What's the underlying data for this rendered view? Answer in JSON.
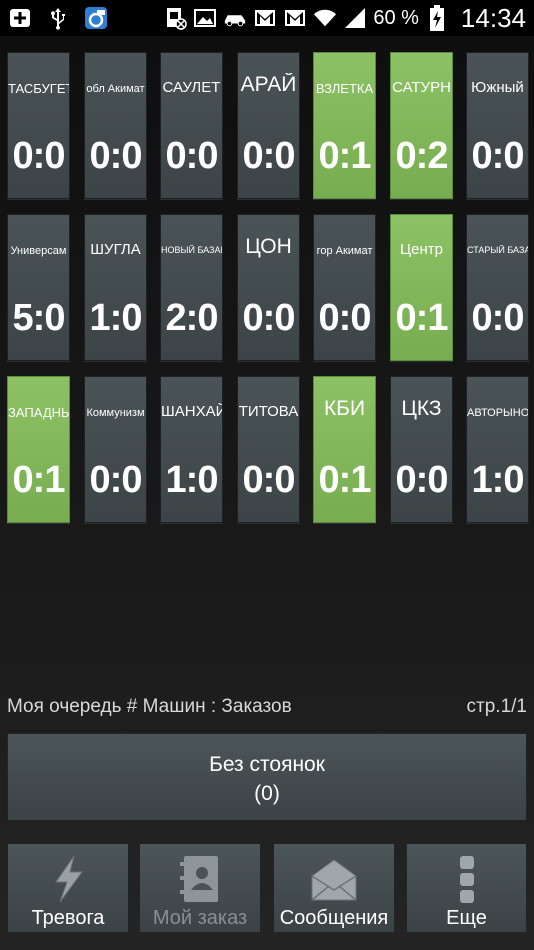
{
  "status_bar": {
    "battery_percent": "60 %",
    "time": "14:34",
    "icons_left": [
      "add-icon",
      "usb-icon",
      "app-icon"
    ],
    "icons_right": [
      "blocked-sim-icon",
      "image-icon",
      "car-icon",
      "gmail-icon",
      "gmail-icon",
      "wifi-icon",
      "signal-icon",
      "battery-charging-icon"
    ]
  },
  "tiles": [
    {
      "label": "ТАСБУГЕТ",
      "score": "0:0",
      "active": false
    },
    {
      "label": "обл Акимат",
      "score": "0:0",
      "active": false
    },
    {
      "label": "САУЛЕТ",
      "score": "0:0",
      "active": false
    },
    {
      "label": "АРАЙ",
      "score": "0:0",
      "active": false
    },
    {
      "label": "ВЗЛЕТКА",
      "score": "0:1",
      "active": true
    },
    {
      "label": "САТУРН",
      "score": "0:2",
      "active": true
    },
    {
      "label": "Южный",
      "score": "0:0",
      "active": false
    },
    {
      "label": "Универсам",
      "score": "5:0",
      "active": false
    },
    {
      "label": "ШУГЛА",
      "score": "1:0",
      "active": false
    },
    {
      "label": "НОВЫЙ БАЗАР",
      "score": "2:0",
      "active": false
    },
    {
      "label": "ЦОН",
      "score": "0:0",
      "active": false
    },
    {
      "label": "гор Акимат",
      "score": "0:0",
      "active": false
    },
    {
      "label": "Центр",
      "score": "0:1",
      "active": true
    },
    {
      "label": "СТАРЫЙ БАЗАР",
      "score": "0:0",
      "active": false
    },
    {
      "label": "ЗАПАДНЫЙ",
      "score": "0:1",
      "active": true
    },
    {
      "label": "Коммунизм",
      "score": "0:0",
      "active": false
    },
    {
      "label": "ШАНХАЙ",
      "score": "1:0",
      "active": false
    },
    {
      "label": "ТИТОВА",
      "score": "0:0",
      "active": false
    },
    {
      "label": "КБИ",
      "score": "0:1",
      "active": true
    },
    {
      "label": "ЦКЗ",
      "score": "0:0",
      "active": false
    },
    {
      "label": "АВТОРЫНОК",
      "score": "1:0",
      "active": false
    }
  ],
  "queue": {
    "label": "Моя очередь # Машин : Заказов",
    "page": "стр.1/1"
  },
  "main_button": {
    "line1": "Без стоянок",
    "line2": "(0)"
  },
  "nav": [
    {
      "label": "Тревога",
      "icon": "lightning-icon",
      "enabled": true
    },
    {
      "label": "Мой заказ",
      "icon": "contact-book-icon",
      "enabled": false
    },
    {
      "label": "Сообщения",
      "icon": "envelope-icon",
      "enabled": true
    },
    {
      "label": "Еще",
      "icon": "more-dots-icon",
      "enabled": true
    }
  ],
  "colors": {
    "tile_default": "#434b4e",
    "tile_active": "#82b75b",
    "background": "#1a1a1a"
  }
}
